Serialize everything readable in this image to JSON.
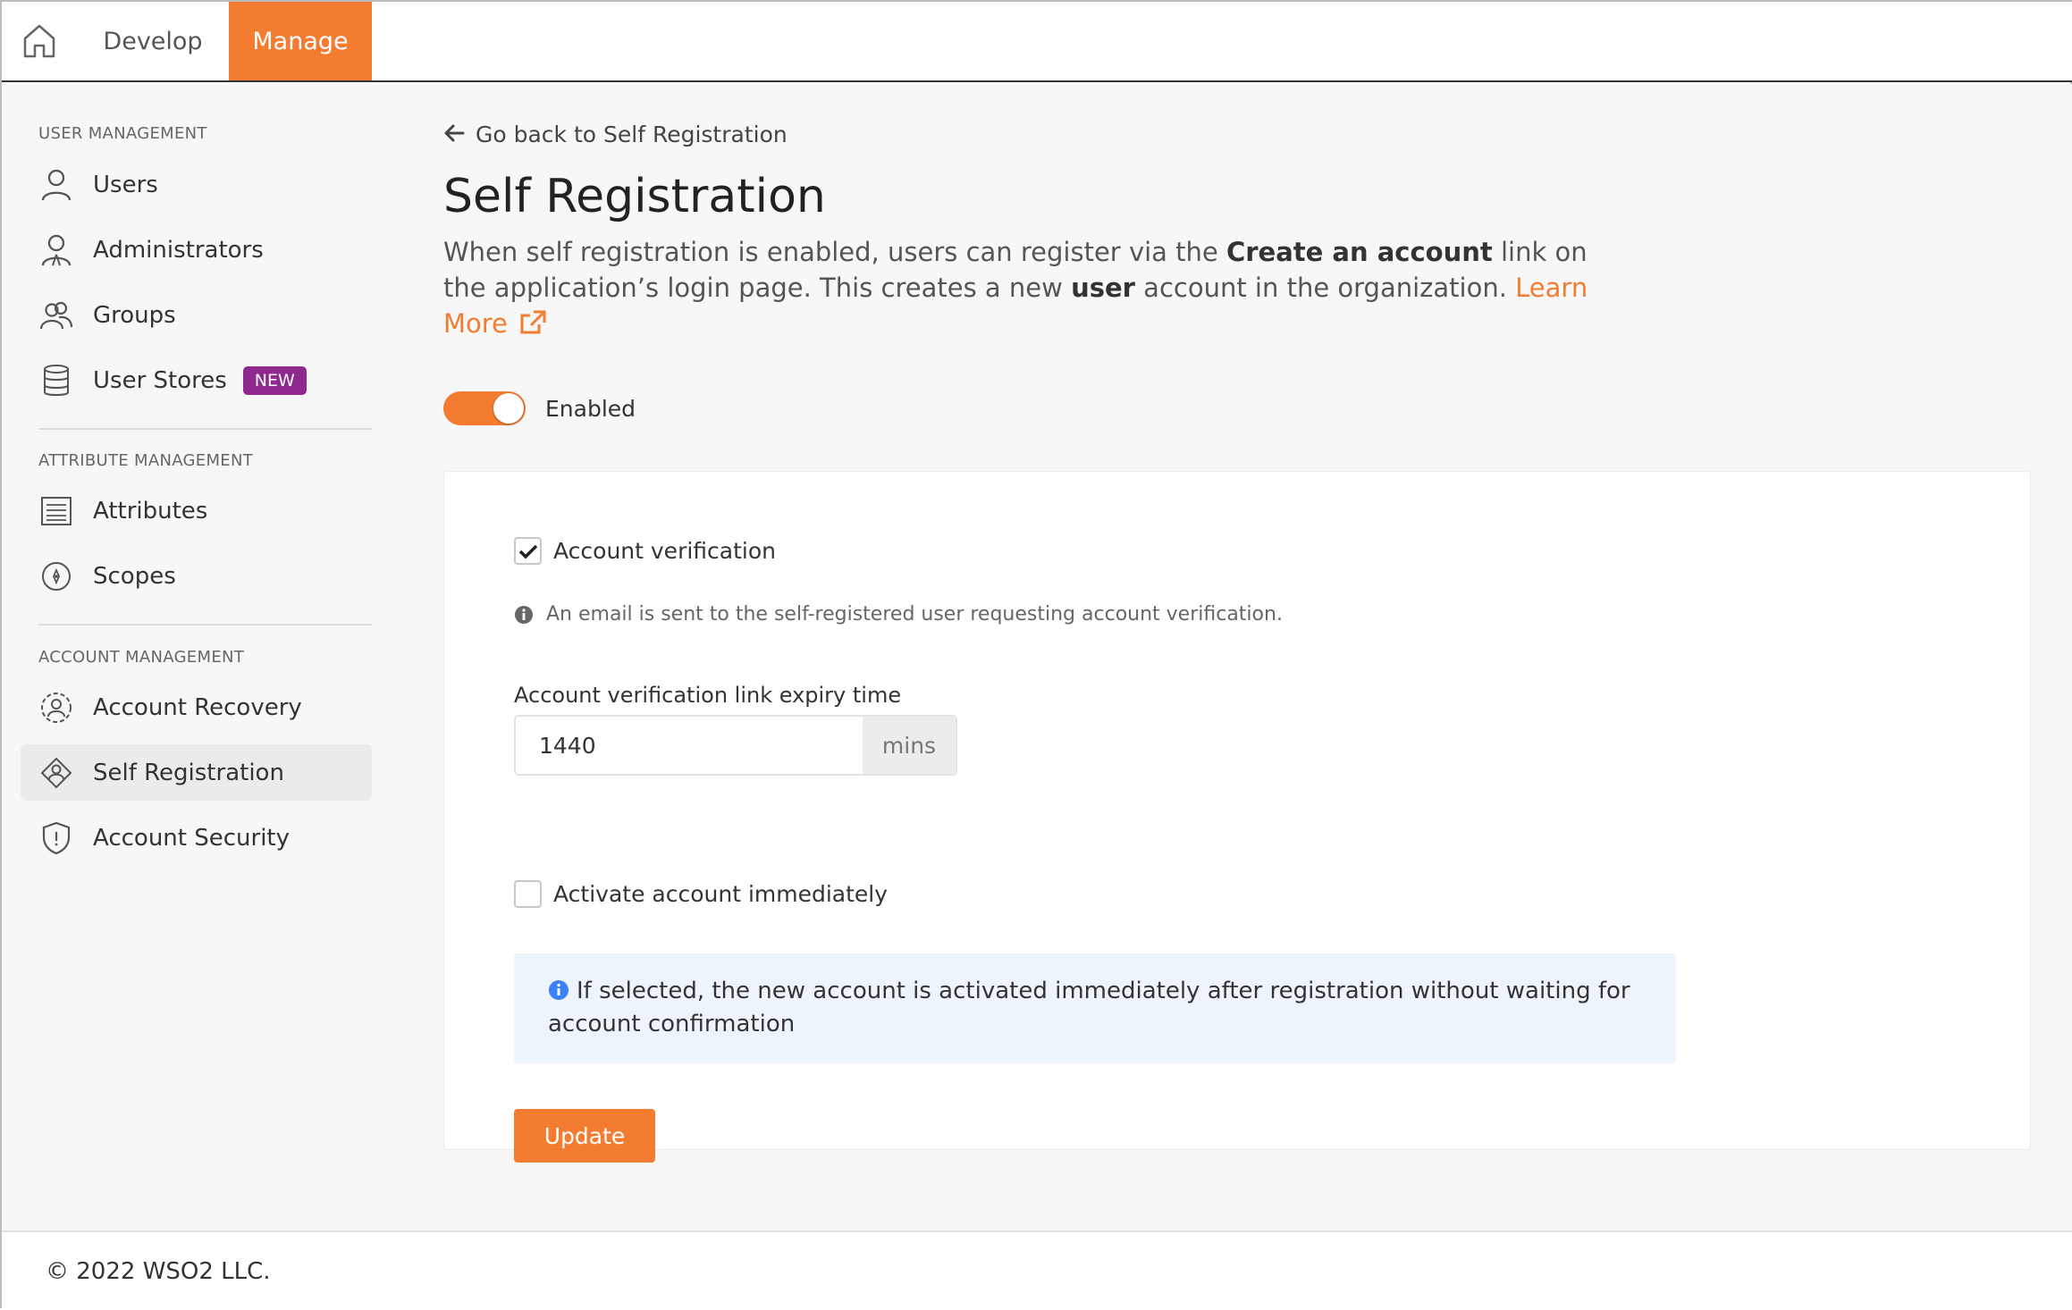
{
  "topbar": {
    "tabs": [
      {
        "label": "Develop",
        "active": false
      },
      {
        "label": "Manage",
        "active": true
      }
    ]
  },
  "sidebar": {
    "sections": [
      {
        "title": "USER MANAGEMENT"
      },
      {
        "title": "ATTRIBUTE MANAGEMENT"
      },
      {
        "title": "ACCOUNT MANAGEMENT"
      }
    ],
    "items": [
      {
        "label": "Users",
        "icon": "user-icon"
      },
      {
        "label": "Administrators",
        "icon": "admin-icon"
      },
      {
        "label": "Groups",
        "icon": "groups-icon"
      },
      {
        "label": "User Stores",
        "icon": "database-icon",
        "badge": "NEW"
      },
      {
        "label": "Attributes",
        "icon": "attributes-icon"
      },
      {
        "label": "Scopes",
        "icon": "scopes-icon"
      },
      {
        "label": "Account Recovery",
        "icon": "account-recovery-icon"
      },
      {
        "label": "Self Registration",
        "icon": "self-registration-icon",
        "active": true
      },
      {
        "label": "Account Security",
        "icon": "shield-icon"
      }
    ]
  },
  "main": {
    "back_link": "Go back to Self Registration",
    "title": "Self Registration",
    "description": {
      "part1": "When self registration is enabled, users can register via the ",
      "bold1": "Create an account",
      "part2": " link on the application’s login page. This creates a new ",
      "bold2": "user",
      "part3": " account in the organization. ",
      "learn_more": "Learn More"
    },
    "toggle": {
      "label": "Enabled",
      "on": true
    },
    "form": {
      "account_verification": {
        "label": "Account verification",
        "checked": true
      },
      "hint": "An email is sent to the self-registered user requesting account verification.",
      "expiry": {
        "label": "Account verification link expiry time",
        "value": "1440",
        "unit": "mins"
      },
      "activate_immediately": {
        "label": "Activate account immediately",
        "checked": false
      },
      "info": "If selected, the new account is activated immediately after registration without waiting for account confirmation",
      "update_label": "Update"
    }
  },
  "footer": {
    "copyright": "© 2022 WSO2 LLC."
  },
  "colors": {
    "accent": "#f47c31",
    "badge": "#8e2a8e",
    "info_bg": "#eef4fb",
    "info_icon": "#3b82f6"
  }
}
